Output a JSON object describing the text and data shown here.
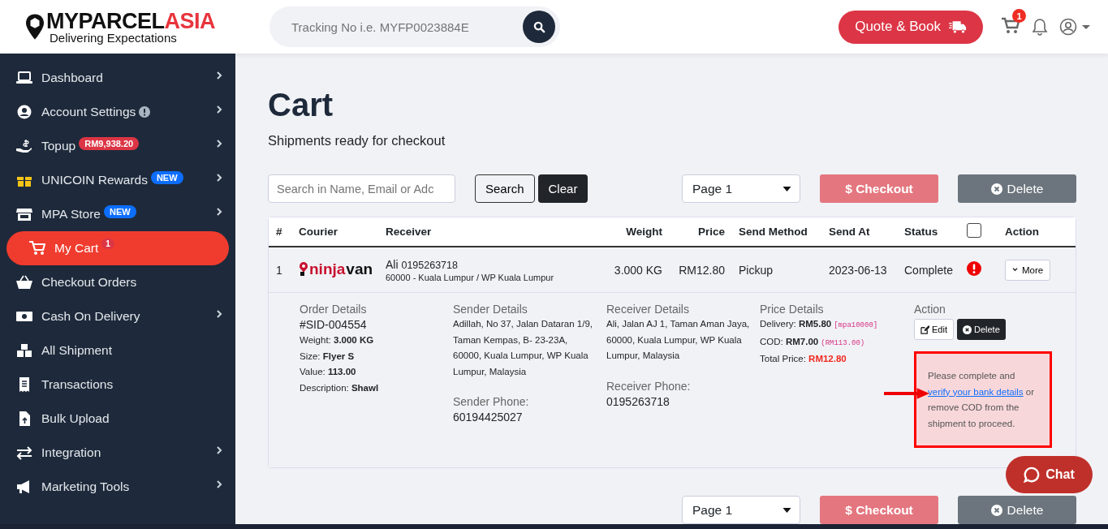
{
  "header": {
    "logo": {
      "brand_main": "MYPARCEL",
      "brand_accent": "ASIA",
      "tagline": "Delivering Expectations"
    },
    "tracking": {
      "placeholder": "Tracking No i.e. MYFP0023884E"
    },
    "quote_button": "Quote & Book",
    "cart_badge": "1"
  },
  "sidebar": {
    "items": [
      {
        "label": "Dashboard",
        "expandable": true,
        "selected": false
      },
      {
        "label": "Account Settings",
        "expandable": true,
        "selected": false,
        "info": true
      },
      {
        "label": "Topup",
        "expandable": true,
        "selected": false,
        "badge": {
          "text": "RM9,938.20",
          "color": "#dc3545"
        }
      },
      {
        "label": "UNICOIN Rewards",
        "expandable": true,
        "selected": false,
        "badge": {
          "text": "NEW",
          "color": "#0d6efd"
        }
      },
      {
        "label": "MPA Store",
        "expandable": true,
        "selected": false,
        "badge": {
          "text": "NEW",
          "color": "#0d6efd"
        }
      },
      {
        "label": "My Cart",
        "expandable": false,
        "selected": true,
        "badge": {
          "text": "1",
          "color": "#dc3545"
        }
      },
      {
        "label": "Checkout Orders",
        "expandable": false,
        "selected": false
      },
      {
        "label": "Cash On Delivery",
        "expandable": true,
        "selected": false
      },
      {
        "label": "All Shipment",
        "expandable": false,
        "selected": false
      },
      {
        "label": "Transactions",
        "expandable": false,
        "selected": false
      },
      {
        "label": "Bulk Upload",
        "expandable": false,
        "selected": false
      },
      {
        "label": "Integration",
        "expandable": true,
        "selected": false
      },
      {
        "label": "Marketing Tools",
        "expandable": true,
        "selected": false
      }
    ]
  },
  "page": {
    "title": "Cart",
    "subtitle": "Shipments ready for checkout"
  },
  "toolbar": {
    "search": {
      "placeholder": "Search in Name, Email or Adc"
    },
    "search_button": "Search",
    "clear_button": "Clear",
    "page_select": "Page 1",
    "checkout_button": "$ Checkout",
    "delete_button": "Delete"
  },
  "table": {
    "columns": [
      "#",
      "Courier",
      "Receiver",
      "Weight",
      "Price",
      "Send Method",
      "Send At",
      "Status",
      "Action"
    ],
    "select_all_checked": false,
    "rows": [
      {
        "index": "1",
        "courier_logo": [
          "ninja",
          "van"
        ],
        "receiver_name": "Ali",
        "receiver_phone": "0195263718",
        "receiver_area": "60000 - Kuala Lumpur / WP Kuala Lumpur",
        "weight": "3.000 KG",
        "price": "RM12.80",
        "send_method": "Pickup",
        "send_at": "2023-06-13",
        "status": "Complete",
        "alert": true,
        "more_button": "More",
        "details": {
          "order": {
            "heading": "Order Details",
            "id": "#SID-004554",
            "lines": [
              "Weight: **3.000 KG**",
              "Size: **Flyer S**",
              "Value: **113.00**",
              "Description: **Shawl**"
            ]
          },
          "sender": {
            "heading": "Sender Details",
            "address": "Adillah, No 37, Jalan Dataran 1/9, Taman Kempas, B- 23-23A, 60000, Kuala Lumpur, WP Kuala Lumpur, Malaysia",
            "phone_label": "Sender Phone:",
            "phone": "60194425027"
          },
          "receiver": {
            "heading": "Receiver Details",
            "address": "Ali, Jalan AJ 1, Taman Aman Jaya, 60000, Kuala Lumpur, WP Kuala Lumpur, Malaysia",
            "phone_label": "Receiver Phone:",
            "phone": "0195263718"
          },
          "price": {
            "heading": "Price Details",
            "lines": [
              {
                "text": "Delivery: **RM5.80**",
                "note": "[mpa10000]"
              },
              {
                "text": "COD: **RM7.00**",
                "note": "(RM113.00)"
              }
            ],
            "total_label": "Total Price:",
            "total": "RM12.80"
          },
          "action": {
            "heading": "Action",
            "edit_button": "Edit",
            "delete_button": "Delete"
          },
          "warning": {
            "before": "Please complete and",
            "link": "verify your bank details",
            "after": "or remove COD from the shipment to proceed."
          }
        }
      }
    ]
  },
  "bottom_toolbar": {
    "page_select": "Page 1",
    "checkout_button": "$ Checkout",
    "delete_button": "Delete"
  },
  "chat_button": "Chat"
}
